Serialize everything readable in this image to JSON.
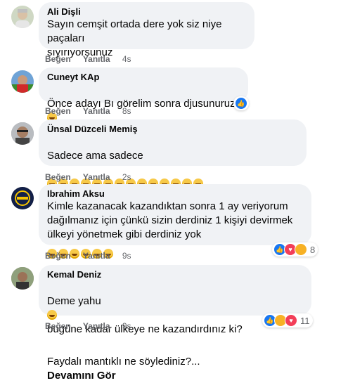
{
  "labels": {
    "like": "Beğen",
    "reply": "Yanıtla"
  },
  "comments": [
    {
      "author": "Ali Dişli",
      "text": "Sayın cemşit ortada dere yok siz niye paçaları\nsıyırıyorsunuz",
      "time": "4s"
    },
    {
      "author": "Cuneyt KAp",
      "text": "Önce adayı Bı görelim sonra djusunuruz",
      "time": "8s"
    },
    {
      "author": "Ünsal Düzceli Memiş",
      "text": "Sadece ama sadece",
      "time": "2s"
    },
    {
      "author": "Ibrahim Aksu",
      "text": "Kimle kazanacak kazandıktan sonra 1 ay veriyorum\ndağılmanız için çünkü sizin derdiniz 1 kişiyi devirmek\nülkeyi yönetmek gibi derdiniz yok",
      "time": "9s",
      "reaction_count": "8"
    },
    {
      "author": "Kemal Deniz",
      "text_line1a": "Deme yahu",
      "text_line1b": "bugüne kadar ülkeye ne kazandırdınız ki?",
      "text_line2": "Faydalı mantıklı ne söylediniz?...",
      "see_more": "Devamını Gör",
      "time": "9s",
      "reaction_count": "11"
    }
  ],
  "icons": [
    "like-reaction-icon",
    "love-reaction-icon",
    "sad-reaction-icon",
    "haha-reaction-icon",
    "laughing-emoji-icon",
    "smiley-emoji-icon"
  ],
  "colors": {
    "bubble": "#f0f2f5",
    "meta": "#65676b",
    "like": "#1877f2"
  }
}
